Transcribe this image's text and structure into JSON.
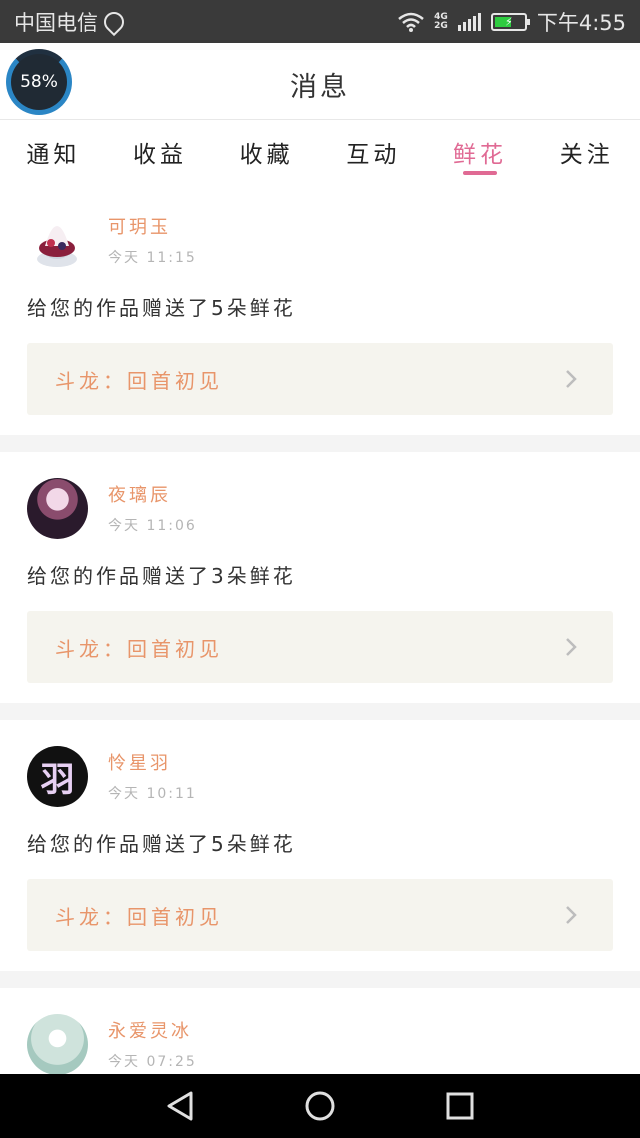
{
  "status": {
    "carrier": "中国电信",
    "network_top": "4G",
    "network_bottom": "2G",
    "time": "下午4:55"
  },
  "header": {
    "title": "消息",
    "gauge_value": "58%"
  },
  "tabs": [
    {
      "label": "通知",
      "active": false
    },
    {
      "label": "收益",
      "active": false
    },
    {
      "label": "收藏",
      "active": false
    },
    {
      "label": "互动",
      "active": false
    },
    {
      "label": "鲜花",
      "active": true
    },
    {
      "label": "关注",
      "active": false
    }
  ],
  "messages": [
    {
      "name": "可玥玉",
      "time": "今天 11:15",
      "text": "给您的作品赠送了5朵鲜花",
      "work": "斗龙：回首初见"
    },
    {
      "name": "夜璃辰",
      "time": "今天 11:06",
      "text": "给您的作品赠送了3朵鲜花",
      "work": "斗龙：回首初见"
    },
    {
      "name": "怜星羽",
      "time": "今天 10:11",
      "text": "给您的作品赠送了5朵鲜花",
      "work": "斗龙：回首初见",
      "avatar_text": "羽"
    },
    {
      "name": "永爱灵冰",
      "time": "今天 07:25"
    }
  ],
  "colors": {
    "accent": "#e06a94",
    "name": "#e8956a",
    "status_bar": "#3a3a3a",
    "work_bg": "#f5f4ee"
  },
  "icons": {
    "back": "back-triangle-icon",
    "home": "home-circle-icon",
    "recents": "recents-square-icon",
    "chevron": "chevron-right-icon"
  }
}
